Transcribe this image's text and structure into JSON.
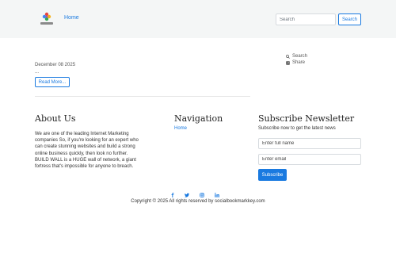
{
  "header": {
    "nav_home": "Home",
    "search_placeholder": "Search",
    "search_button": "Search"
  },
  "post": {
    "date": "December 08 2025",
    "excerpt": "...",
    "read_more": "Read More..."
  },
  "sidebar": {
    "search_label": "Search",
    "share_label": "Share"
  },
  "footer": {
    "about": {
      "heading": "About Us",
      "text": "We are one of the leading Internet Marketing companies So, if you're looking for an expert who can create stunning websites and build a strong online business quickly, then look no further. BUILD WALL is a HUGE wall of network, a giant fortress that's impossible for anyone to breach."
    },
    "navigation": {
      "heading": "Navigation",
      "home": "Home"
    },
    "newsletter": {
      "heading": "Subscribe Newsletter",
      "subtitle": "Subscribe now to get the latest news",
      "name_placeholder": "Enter full name",
      "email_placeholder": "Enter email",
      "button": "Subscribe"
    },
    "social": [
      "facebook-icon",
      "twitter-icon",
      "instagram-icon",
      "linkedin-icon"
    ],
    "copyright": "Copyright © 2025 All rights reserved by socialbookmarkkey.com"
  },
  "colors": {
    "accent": "#1a7ae0",
    "header_bg": "#f4f6f6"
  }
}
